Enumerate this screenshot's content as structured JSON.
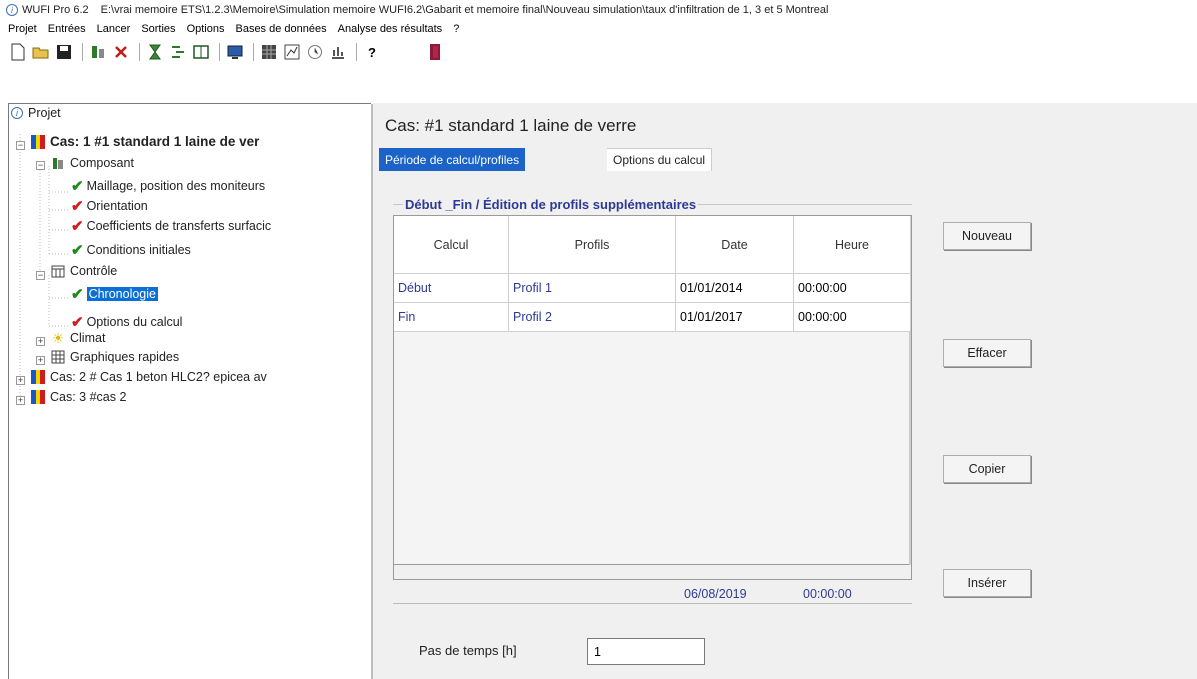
{
  "window": {
    "app_title": "WUFI Pro 6.2",
    "path": "E:\\vrai memoire ETS\\1.2.3\\Memoire\\Simulation memoire WUFI6.2\\Gabarit et memoire final\\Nouveau simulation\\taux d'infiltration de 1, 3 et 5  Montreal"
  },
  "menu": [
    "Projet",
    "Entrées",
    "Lancer",
    "Sorties",
    "Options",
    "Bases de données",
    "Analyse des résultats",
    "?"
  ],
  "toolbar": {
    "icons": [
      "new-file-icon",
      "open-folder-icon",
      "save-icon",
      "component-icon",
      "delete-icon",
      "hourglass-icon",
      "sequence-icon",
      "layout-icon",
      "monitor-icon",
      "grid-icon",
      "graph-icon",
      "clock-icon",
      "chart-icon",
      "help-icon",
      "exit-icon"
    ],
    "help_label": "?"
  },
  "tree": {
    "root": "Projet",
    "case1": "Cas: 1 #1 standard  1 laine de ver",
    "composant": "Composant",
    "maillage": "Maillage, position des moniteurs",
    "orientation": "Orientation",
    "coefficients": "Coefficients de transferts surfacic",
    "conditions": "Conditions initiales",
    "controle": "Contrôle",
    "chronologie": "Chronologie",
    "options_calcul": "Options du calcul",
    "climat": "Climat",
    "graphiques": "Graphiques rapides",
    "case2": "Cas: 2 # Cas 1 beton HLC2? epicea  av",
    "case3": "Cas: 3 #cas 2"
  },
  "main": {
    "case_title": "Cas:  #1 standard  1 laine de verre",
    "tabs": [
      {
        "label": "Période de calcul/profiles",
        "active": true
      },
      {
        "label": "Options du calcul",
        "active": false
      }
    ],
    "group_title": "Début _Fin / Édition de profils supplémentaires",
    "columns": [
      "Calcul",
      "Profils",
      "Date",
      "Heure"
    ],
    "rows": [
      {
        "calcul": "Début",
        "profil": "Profil 1",
        "date": "01/01/2014",
        "heure": "00:00:00"
      },
      {
        "calcul": "Fin",
        "profil": "Profil 2",
        "date": "01/01/2017",
        "heure": "00:00:00"
      }
    ],
    "footer_date": "06/08/2019",
    "footer_time": "00:00:00",
    "buttons": {
      "nouveau": "Nouveau",
      "effacer": "Effacer",
      "copier": "Copier",
      "inserer": "Insérer"
    },
    "pas_label": "Pas de temps [h]",
    "pas_value": "1"
  },
  "colors": {
    "accent": "#1b63c8",
    "link_text": "#2c3a95",
    "check_green": "#1a8a1a",
    "check_red": "#d21b1b"
  }
}
